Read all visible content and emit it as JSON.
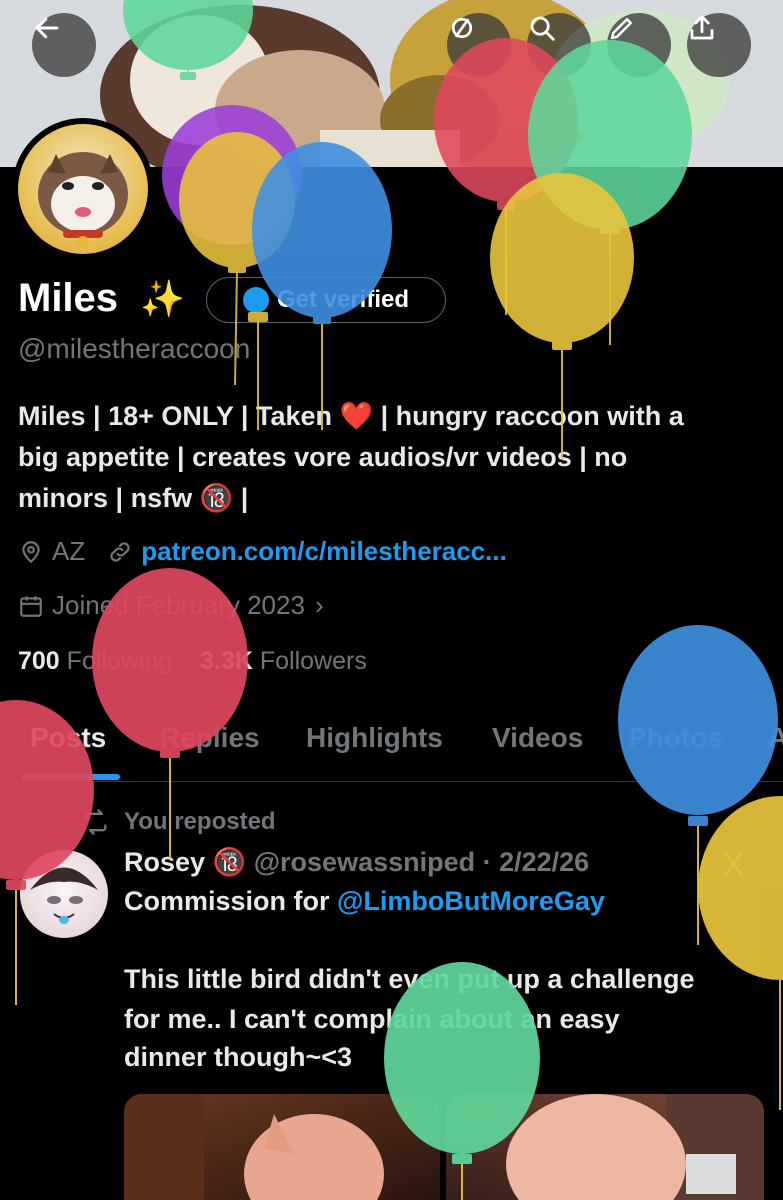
{
  "profile": {
    "name": "Miles",
    "sparkle": "✨",
    "verify_label": "Get verified",
    "handle": "@milestheraccoon",
    "bio_lines": [
      "Miles | 18+ ONLY | Taken ❤️ | hungry raccoon with a",
      "big appetite | creates vore audios/vr videos | no",
      "minors | nsfw 🔞 |"
    ],
    "location": "AZ",
    "link": "patreon.com/c/milestheracc...",
    "joined": "Joined February 2023",
    "following_count": "700",
    "following_label": "Following",
    "followers_count": "3.3K",
    "followers_label": "Followers"
  },
  "tabs": [
    "Posts",
    "Replies",
    "Highlights",
    "Videos",
    "Photos",
    "A"
  ],
  "post": {
    "reposted_label": "You reposted",
    "author": "Rosey",
    "author_badge": "🔞",
    "handle_date": "@rosewassniped · 2/22/26",
    "line1_prefix": "Commission for ",
    "line1_mention": "@LimboButMoreGay",
    "line2": "This little bird didn't even put up a challenge",
    "line3": "for me.. I can't complain about an easy",
    "line4": "dinner though~<3",
    "x_logo": "X"
  },
  "colors": {
    "accent": "#1d9bf0",
    "muted": "#71767b",
    "text": "#e7e9ea",
    "background": "#000000",
    "balloon_green": "#5fd79a",
    "balloon_red": "#e0485f",
    "balloon_yellow": "#e8c43c",
    "balloon_blue": "#3f8fe0",
    "balloon_purple": "#9b3fd8"
  },
  "icons": {
    "back": "arrow-left-icon",
    "grok": "grok-icon",
    "search": "search-icon",
    "edit": "pencil-icon",
    "share": "share-icon",
    "location": "location-pin-icon",
    "link": "link-icon",
    "calendar": "calendar-icon",
    "repost": "repost-icon"
  }
}
